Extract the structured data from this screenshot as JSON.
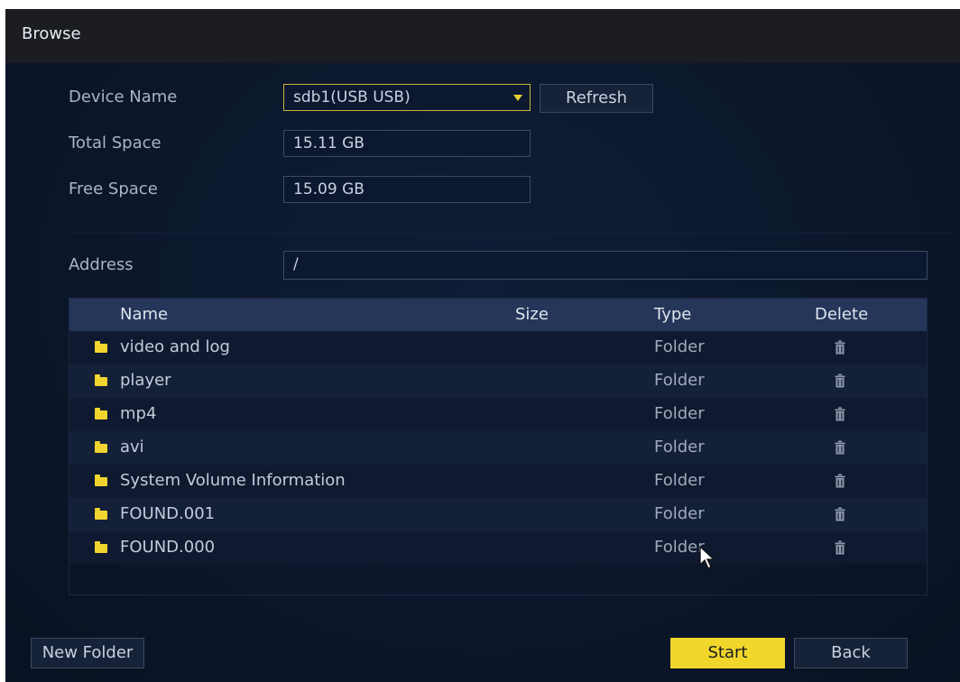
{
  "window": {
    "title": "Browse"
  },
  "form": {
    "device_name_label": "Device Name",
    "device_name_value": "sdb1(USB USB)",
    "refresh_label": "Refresh",
    "total_space_label": "Total Space",
    "total_space_value": "15.11 GB",
    "free_space_label": "Free Space",
    "free_space_value": "15.09 GB",
    "address_label": "Address",
    "address_value": "/"
  },
  "table": {
    "headers": {
      "name": "Name",
      "size": "Size",
      "type": "Type",
      "delete": "Delete"
    },
    "rows": [
      {
        "name": "video and log",
        "size": "",
        "type": "Folder"
      },
      {
        "name": "player",
        "size": "",
        "type": "Folder"
      },
      {
        "name": "mp4",
        "size": "",
        "type": "Folder"
      },
      {
        "name": "avi",
        "size": "",
        "type": "Folder"
      },
      {
        "name": "System Volume Information",
        "size": "",
        "type": "Folder"
      },
      {
        "name": "FOUND.001",
        "size": "",
        "type": "Folder"
      },
      {
        "name": "FOUND.000",
        "size": "",
        "type": "Folder"
      }
    ]
  },
  "footer": {
    "new_folder_label": "New Folder",
    "start_label": "Start",
    "back_label": "Back"
  },
  "icons": {
    "dropdown": "chevron-down-icon",
    "folder": "folder-icon",
    "delete": "trash-icon",
    "pointer": "mouse-cursor-icon"
  },
  "colors": {
    "accent": "#f1d62c",
    "background": "#0b1629",
    "header_row": "#25365a",
    "titlebar": "#1b1d22"
  }
}
